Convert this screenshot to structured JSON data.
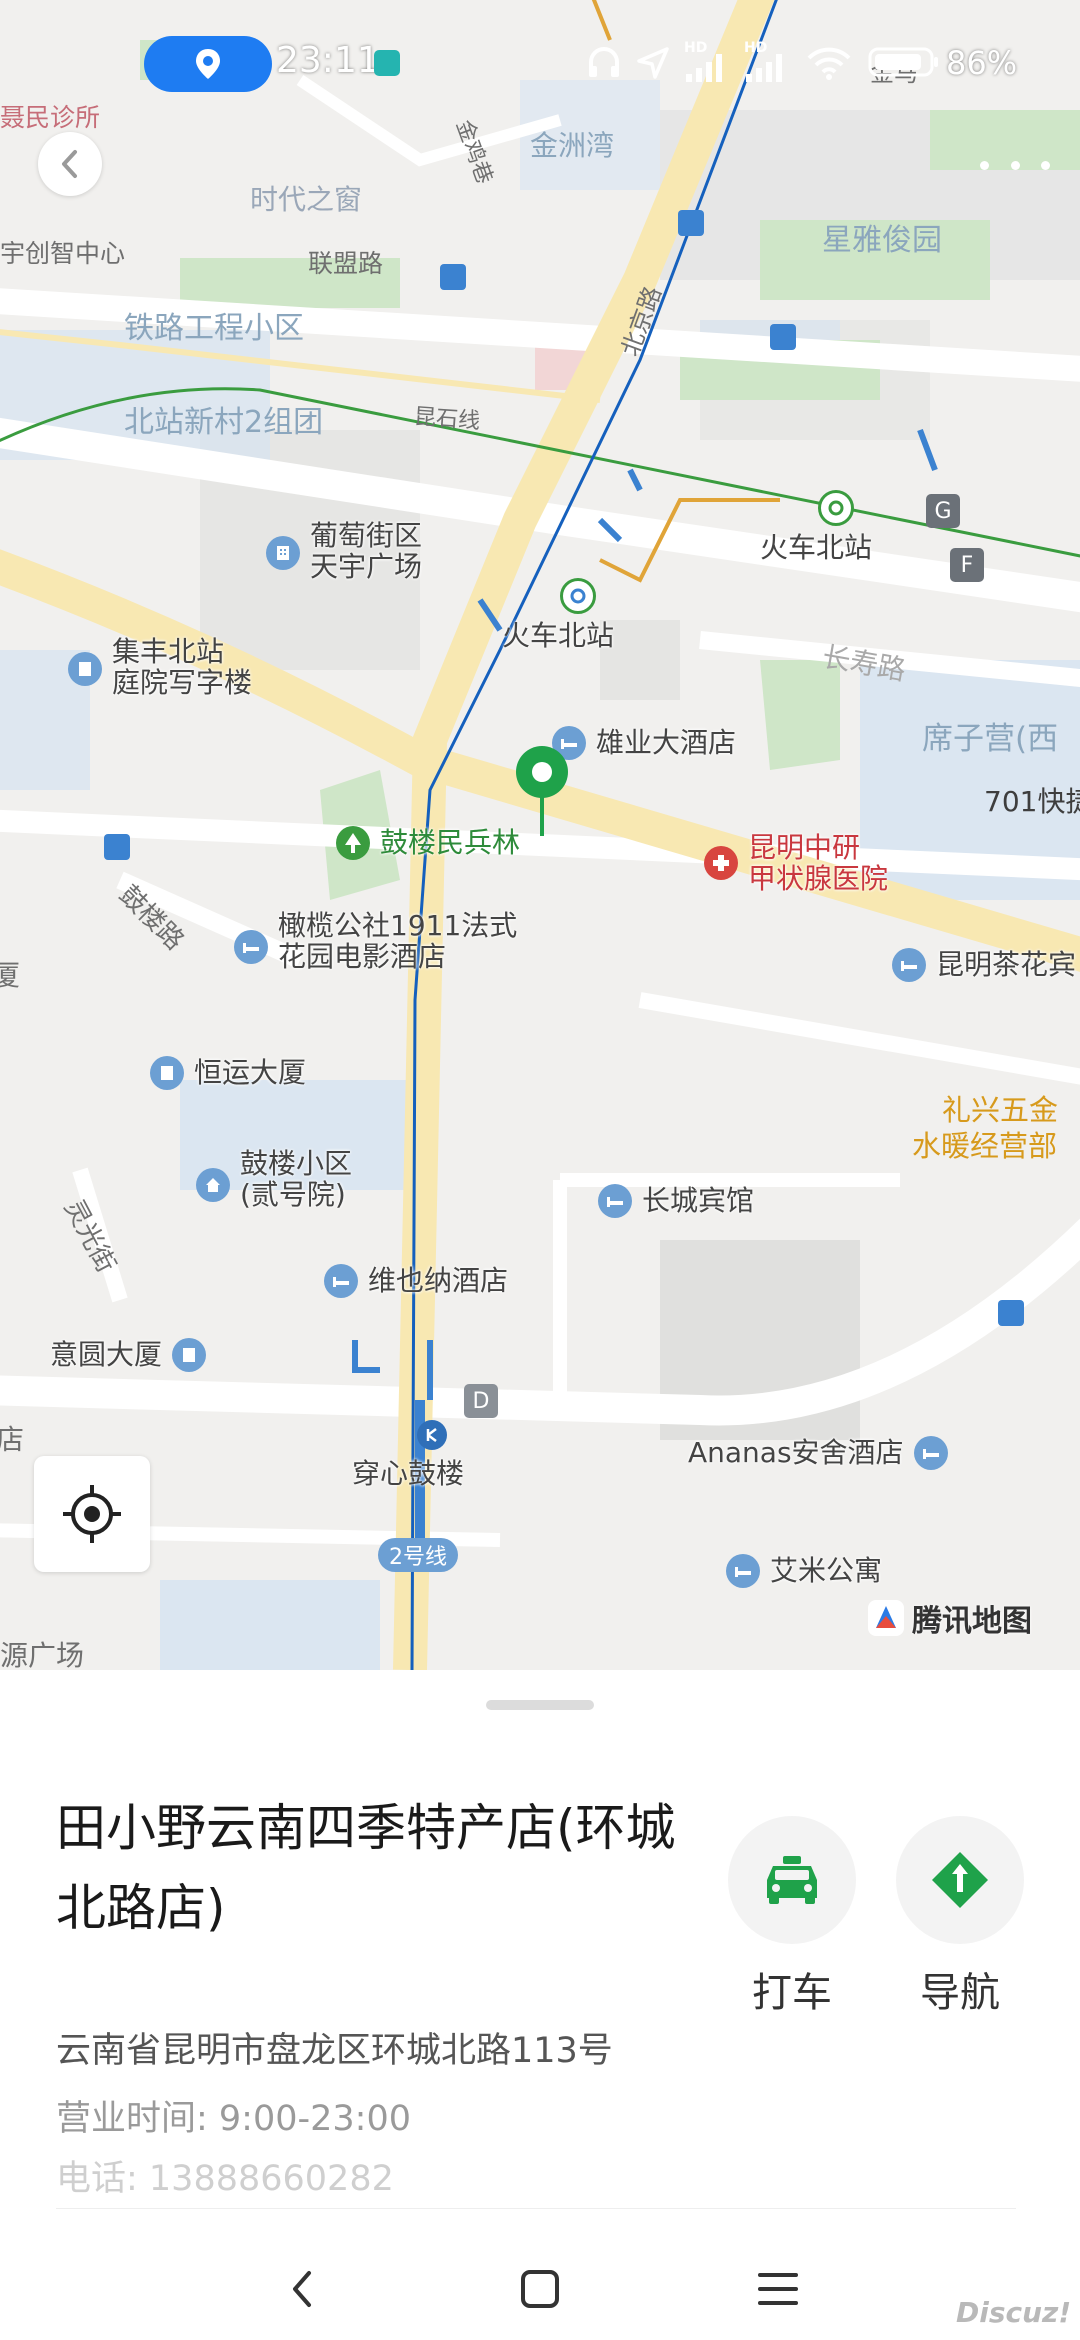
{
  "status_bar": {
    "time": "23:11",
    "battery": "86%",
    "hd1": "HD",
    "hd2": "HD"
  },
  "map": {
    "labels": {
      "niesmin_clinic": "聂民诊所",
      "shidai_chuang": "时代之窗",
      "jinshan_wan": "金洲湾",
      "yuchuangzhi": "宇创智中心",
      "lianmeng_road": "联盟路",
      "railway_eng": "铁路工程小区",
      "beizhan_xincun": "北站新村2组团",
      "xingya": "星雅俊园",
      "kunshi_road": "昆石线",
      "changshou_road": "长寿路",
      "xizi_ying": "席子营(西",
      "guloul_road": "鼓楼路",
      "lingguang_road": "灵光街",
      "bei_jing_road": "北京路",
      "jin_ma": "金马",
      "jinyanyuan": "金鸡巷",
      "dashang": "厦",
      "pian_guangchang": "源广场",
      "zhan": "店",
      "lixing": "礼兴五金",
      "lixing2": "水暖经营部",
      "gulou_mbl": "鼓楼民兵林",
      "hosp1": "昆明中研",
      "hosp2": "甲状腺医院",
      "k701": "701快捷",
      "chuanxin": "穿心鼓楼",
      "line2": "2号线",
      "gate_g": "G",
      "gate_f": "F",
      "gate_d": "D"
    },
    "pois": [
      {
        "label": "葡萄街区",
        "label2": "天宇广场"
      },
      {
        "label": "火车北站"
      },
      {
        "label": "火车北站"
      },
      {
        "label": "集丰北站",
        "label2": "庭院写字楼"
      },
      {
        "label": "雄业大酒店"
      },
      {
        "label": "橄榄公社1911法式",
        "label2": "花园电影酒店"
      },
      {
        "label": "昆明茶花宾"
      },
      {
        "label": "恒运大厦"
      },
      {
        "label": "鼓楼小区",
        "label2": "(贰号院)"
      },
      {
        "label": "长城宾馆"
      },
      {
        "label": "维也纳酒店"
      },
      {
        "label": "意圆大厦"
      },
      {
        "label": "Ananas安舍酒店"
      },
      {
        "label": "艾米公寓"
      }
    ],
    "logo_text": "腾讯地图",
    "accent_blue": "#1560bd",
    "pin_green": "#1fa24a"
  },
  "panel": {
    "title": "田小野云南四季特产店(环城北路店)",
    "actions": [
      {
        "label": "打车",
        "icon": "taxi-icon"
      },
      {
        "label": "导航",
        "icon": "navigation-icon"
      }
    ],
    "address": "云南省昆明市盘龙区环城北路113号",
    "hours": "营业时间: 9:00-23:00",
    "phone": "电话: 13888660282"
  },
  "watermark": "Discuz!"
}
